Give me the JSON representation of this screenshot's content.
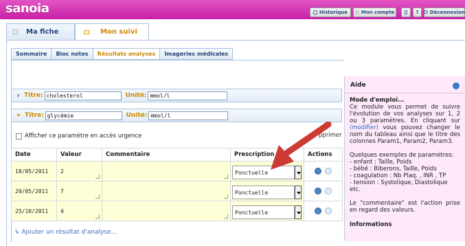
{
  "header": {
    "logo": "sanoia",
    "buttons": [
      {
        "label": "Historique",
        "icon": "history-icon"
      },
      {
        "label": "Mon compte",
        "icon": "user-icon"
      },
      {
        "label": "",
        "icon": "printer-icon"
      },
      {
        "label": "?",
        "icon": "help-icon"
      },
      {
        "label": "Déconnexion",
        "icon": "power-icon"
      }
    ]
  },
  "main_tabs": [
    {
      "label": "Ma fiche",
      "icon": "house-icon"
    },
    {
      "label": "Mon suivi",
      "icon": "folder-icon",
      "active": true
    }
  ],
  "sub_tabs": [
    {
      "label": "Sommaire"
    },
    {
      "label": "Bloc notes"
    },
    {
      "label": "Résultats analyses",
      "active": true
    },
    {
      "label": "Imageries médicales"
    }
  ],
  "sections": [
    {
      "title_label": "Titre:",
      "title_value": "cholesterol",
      "unit_label": "Unité:",
      "unit_value": "mmol/l",
      "collapsed": true
    },
    {
      "title_label": "Titre:",
      "title_value": "glycémie",
      "unit_label": "Unité:",
      "unit_value": "mmol/l",
      "collapsed": false
    }
  ],
  "urgence_label": "Afficher ce paramètre en accès urgence",
  "delete_label": "pprimer",
  "table": {
    "headers": [
      "Date",
      "Valeur",
      "Commentaire",
      "Prescription",
      "Actions"
    ],
    "rows": [
      {
        "date": "18/05/2011",
        "valeur": "2",
        "commentaire": "",
        "prescription": "Ponctuelle"
      },
      {
        "date": "20/05/2011",
        "valeur": "7",
        "commentaire": "",
        "prescription": "Ponctuelle"
      },
      {
        "date": "25/10/2011",
        "valeur": "4",
        "commentaire": "",
        "prescription": "Ponctuelle"
      }
    ]
  },
  "add_result": "↳ Ajouter un résultat d'analyse...",
  "aside": {
    "title": "Aide",
    "mode_title": "Mode d'emploi...",
    "mode_text1": "Ce module vous permet de suivre l'évolution de vos analyses sur 1, 2 ou 3 paramètres. En cliquant sur ",
    "modifier": "(modifier)",
    "mode_text2": " vous pouvez changer le nom du tableau ainsi que le titre des colonnes Param1, Param2, Param3.",
    "examples_title": "Quelques exemples de paramètres:",
    "examples": [
      "- enfant : Taille, Poids",
      "- bébé : Biberons, Taille, Poids",
      "- coagulation : Nb Plaq. , INR , TP",
      "- tension : Systolique, Diastolique",
      "etc."
    ],
    "comment_text": "Le \"commentaire\" est l'action prise en regard des valeurs.",
    "info_title": "Informations"
  },
  "colors": {
    "header": "#d63bba",
    "accent": "#ce8700",
    "link": "#3a6bb8",
    "arrow": "#cc3a33",
    "row_bg": "#ffffd7"
  }
}
